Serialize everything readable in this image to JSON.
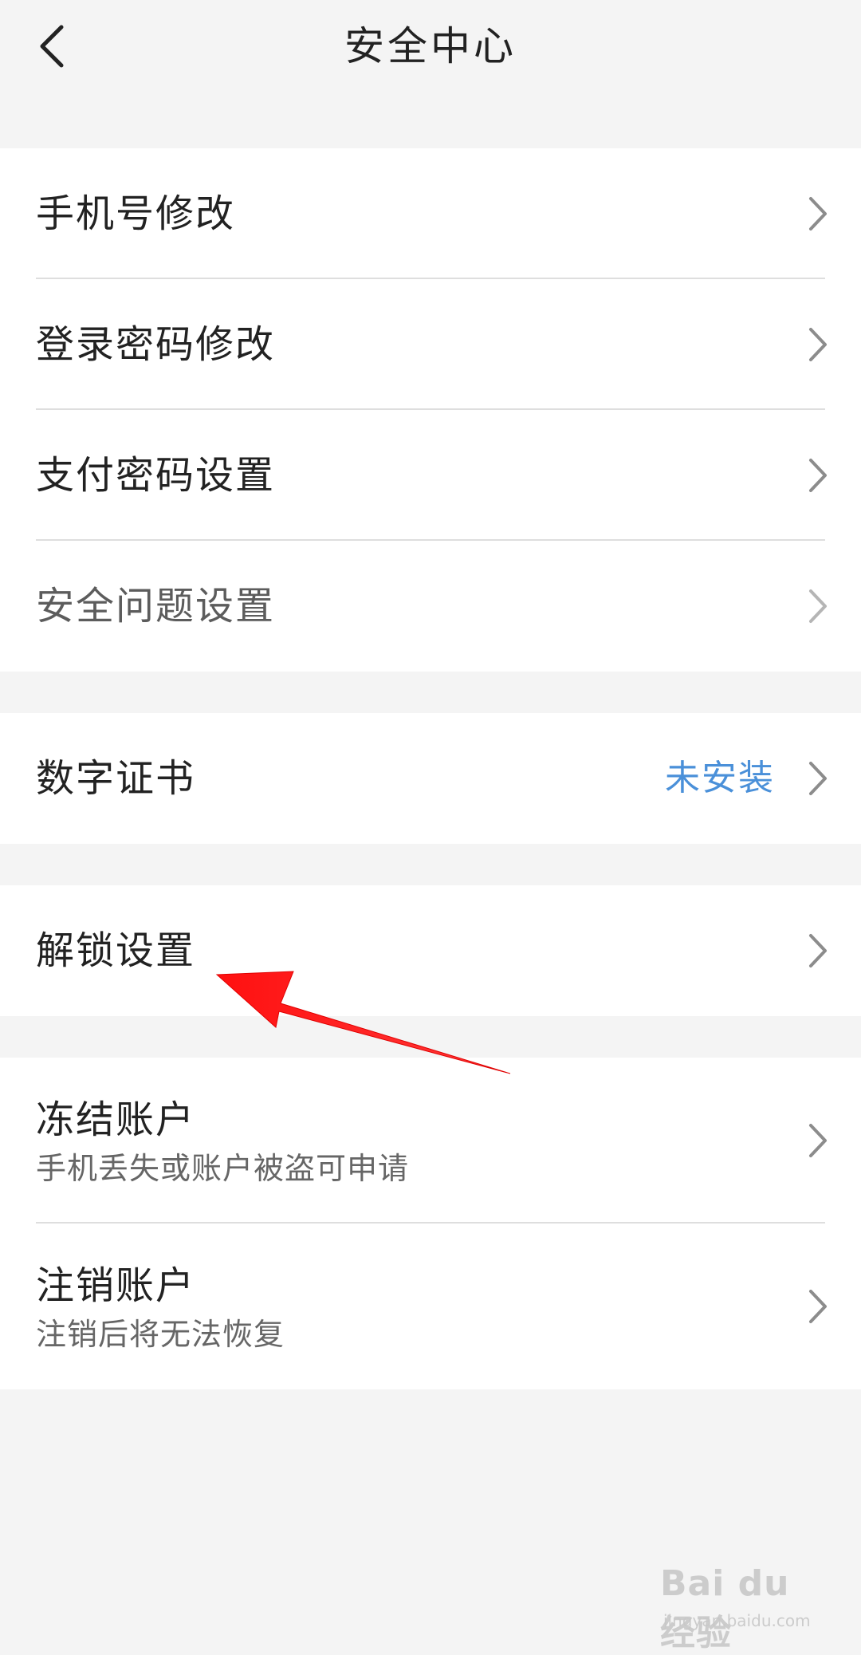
{
  "header": {
    "title": "安全中心",
    "back_icon": "chevron-left-icon"
  },
  "groups": [
    {
      "items": [
        {
          "label": "手机号修改"
        },
        {
          "label": "登录密码修改"
        },
        {
          "label": "支付密码设置"
        },
        {
          "label": "安全问题设置"
        }
      ]
    },
    {
      "items": [
        {
          "label": "数字证书",
          "value": "未安装"
        }
      ]
    },
    {
      "items": [
        {
          "label": "解锁设置"
        }
      ]
    },
    {
      "items": [
        {
          "label": "冻结账户",
          "sub": "手机丢失或账户被盗可申请"
        },
        {
          "label": "注销账户",
          "sub": "注销后将无法恢复"
        }
      ]
    }
  ],
  "colors": {
    "background": "#f4f4f4",
    "card": "#ffffff",
    "accent_value": "#4a90d9",
    "annotation_arrow": "#ff1a1a"
  },
  "watermark": {
    "brand": "Bai du 经验",
    "url": "jingyan.baidu.com"
  }
}
